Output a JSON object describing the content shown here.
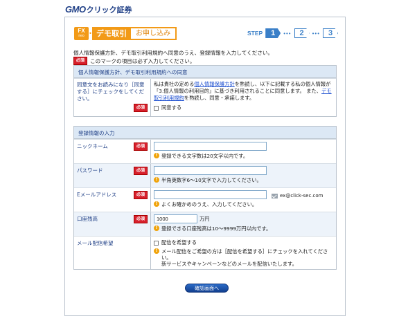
{
  "logo": {
    "gmo": "GMO",
    "rest": "クリック証券"
  },
  "header": {
    "fx_badge_top": "FX",
    "fx_badge_bottom": "neo",
    "demo_label": "デモ取引",
    "apply_label": "お申し込み",
    "step_label": "STEP",
    "steps": [
      "1",
      "2",
      "3"
    ],
    "dots": "•••"
  },
  "intro": "個人情報保護方針、デモ取引利用規約へ同意のうえ、登録情報を入力してください。",
  "required_badge": "必須",
  "required_note": "このマークの項目は必ず入力してください。",
  "consent": {
    "title": "個人情報保護方針、デモ取引利用規約への同意",
    "label": "同意文をお読みになり［同意する］にチェックをしてください。",
    "text_1": "私は貴社の定める",
    "link_1": "個人情報保護方針",
    "text_2": "を熟読し、以下に記載する私の個人情報が「3.個人情報の利用目的」に基づき利用されることに同意します。 また、",
    "link_2": "デモ取引利用規約",
    "text_3": "を熟読し、同意・承諾します。",
    "checkbox_label": "同意する"
  },
  "registration": {
    "title": "登録情報の入力",
    "nickname": {
      "label": "ニックネーム",
      "value": "",
      "hint": "登録できる文字数は20文字以内です。"
    },
    "password": {
      "label": "パスワード",
      "value": "",
      "hint": "半角英数字6～10文字で入力してください。"
    },
    "email": {
      "label": "Eメールアドレス",
      "value": "",
      "example": "ex@click-sec.com",
      "hint": "よくお確かめのうえ、入力してください。"
    },
    "balance": {
      "label": "口座残高",
      "value": "1000",
      "unit": "万円",
      "hint": "登録できる口座残高は10～9999万円以内です。"
    },
    "mail_opt": {
      "label": "メール配信希望",
      "checkbox_label": "配信を希望する",
      "hint_1": "メール配信をご希望の方は［配信を希望する］にチェックを入れてください。",
      "hint_2": "新サービスやキャンペーンなどのメールを配信いたします。"
    }
  },
  "confirm_button": "確認画面へ",
  "info_glyph": "!"
}
